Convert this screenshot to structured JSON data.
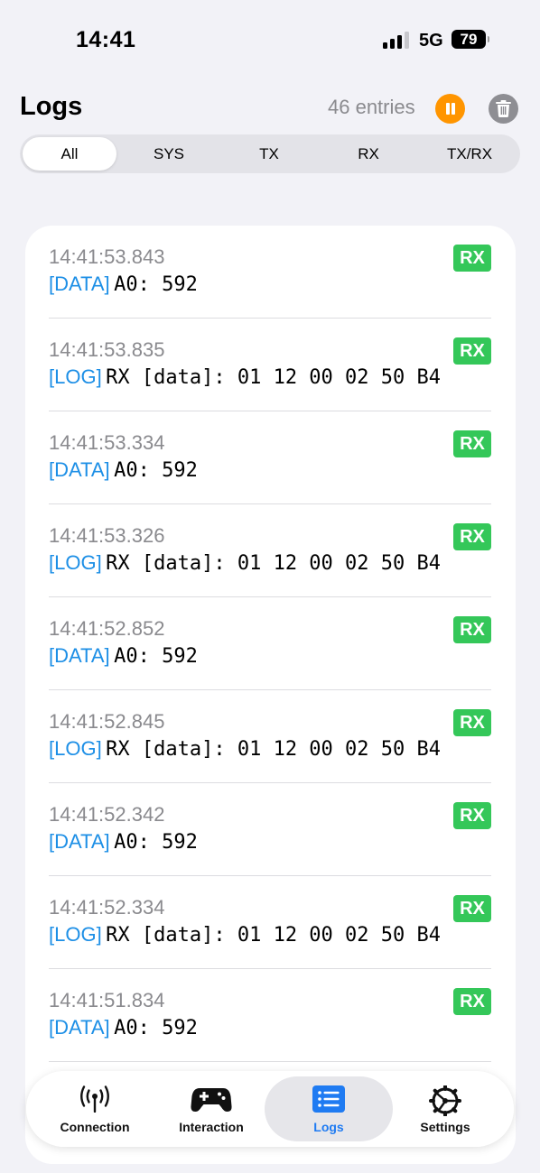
{
  "status_bar": {
    "time": "14:41",
    "network": "5G",
    "battery": "79"
  },
  "header": {
    "title": "Logs",
    "entries": "46 entries"
  },
  "filters": [
    {
      "label": "All",
      "active": true
    },
    {
      "label": "SYS",
      "active": false
    },
    {
      "label": "TX",
      "active": false
    },
    {
      "label": "RX",
      "active": false
    },
    {
      "label": "TX/RX",
      "active": false
    }
  ],
  "logs": [
    {
      "time": "14:41:53.843",
      "tag": "[DATA]",
      "message": "A0: 592",
      "direction": "RX"
    },
    {
      "time": "14:41:53.835",
      "tag": "[LOG]",
      "message": "RX [data]: 01 12 00 02 50 B4",
      "direction": "RX"
    },
    {
      "time": "14:41:53.334",
      "tag": "[DATA]",
      "message": "A0: 592",
      "direction": "RX"
    },
    {
      "time": "14:41:53.326",
      "tag": "[LOG]",
      "message": "RX [data]: 01 12 00 02 50 B4",
      "direction": "RX"
    },
    {
      "time": "14:41:52.852",
      "tag": "[DATA]",
      "message": "A0: 592",
      "direction": "RX"
    },
    {
      "time": "14:41:52.845",
      "tag": "[LOG]",
      "message": "RX [data]: 01 12 00 02 50 B4",
      "direction": "RX"
    },
    {
      "time": "14:41:52.342",
      "tag": "[DATA]",
      "message": "A0: 592",
      "direction": "RX"
    },
    {
      "time": "14:41:52.334",
      "tag": "[LOG]",
      "message": "RX [data]: 01 12 00 02 50 B4",
      "direction": "RX"
    },
    {
      "time": "14:41:51.834",
      "tag": "[DATA]",
      "message": "A0: 592",
      "direction": "RX"
    }
  ],
  "tabs": [
    {
      "label": "Connection",
      "icon": "antenna-icon",
      "active": false
    },
    {
      "label": "Interaction",
      "icon": "gamepad-icon",
      "active": false
    },
    {
      "label": "Logs",
      "icon": "list-icon",
      "active": true
    },
    {
      "label": "Settings",
      "icon": "gear-icon",
      "active": false
    }
  ],
  "colors": {
    "accent": "#1f7bf2",
    "tag": "#1d8fe6",
    "rx_badge": "#34c759",
    "pause": "#ff9500",
    "trash": "#8e8e93"
  }
}
